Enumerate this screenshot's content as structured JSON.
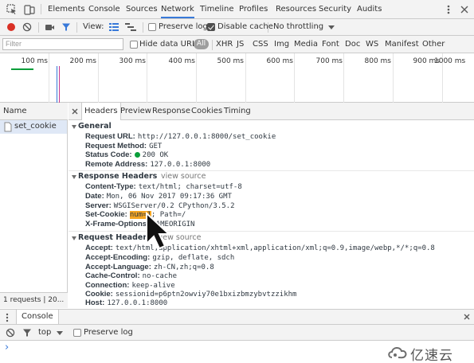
{
  "tabbar": {
    "tabs": [
      "Elements",
      "Console",
      "Sources",
      "Network",
      "Timeline",
      "Profiles",
      "Resources",
      "Security",
      "Audits"
    ],
    "active": "Network"
  },
  "toolbar": {
    "view_label": "View:",
    "preserve_log": "Preserve log",
    "disable_cache": "Disable cache",
    "throttle": "No throttling"
  },
  "filterbar": {
    "placeholder": "Filter",
    "hide_data_urls": "Hide data URLs",
    "all": "All",
    "types": [
      "XHR",
      "JS",
      "CSS",
      "Img",
      "Media",
      "Font",
      "Doc",
      "WS",
      "Manifest",
      "Other"
    ]
  },
  "overview": {
    "ticks": [
      "100 ms",
      "200 ms",
      "300 ms",
      "400 ms",
      "500 ms",
      "600 ms",
      "700 ms",
      "800 ms",
      "900 ms",
      "1000 ms"
    ]
  },
  "requests": {
    "header": "Name",
    "items": [
      "set_cookie"
    ],
    "status": "1 requests  |  20..."
  },
  "details": {
    "tabs": [
      "Headers",
      "Preview",
      "Response",
      "Cookies",
      "Timing"
    ],
    "active": "Headers",
    "general": {
      "title": "General",
      "rows": [
        {
          "name": "Request URL:",
          "value": "http://127.0.0.1:8000/set_cookie"
        },
        {
          "name": "Request Method:",
          "value": "GET"
        },
        {
          "name": "Status Code:",
          "value": "200 OK"
        },
        {
          "name": "Remote Address:",
          "value": "127.0.0.1:8000"
        }
      ]
    },
    "response": {
      "title": "Response Headers",
      "view_source": "view source",
      "rows": [
        {
          "name": "Content-Type:",
          "value": "text/html; charset=utf-8"
        },
        {
          "name": "Date:",
          "value": "Mon, 06 Nov 2017 09:17:36 GMT"
        },
        {
          "name": "Server:",
          "value": "WSGIServer/0.2 CPython/3.5.2"
        },
        {
          "name": "Set-Cookie:",
          "value_highlight": "num=1",
          "value": "; Path=/"
        },
        {
          "name": "X-Frame-Options:",
          "value": "SAMEORIGIN"
        }
      ]
    },
    "request": {
      "title": "Request Headers",
      "view_source": "view source",
      "rows": [
        {
          "name": "Accept:",
          "value": "text/html,application/xhtml+xml,application/xml;q=0.9,image/webp,*/*;q=0.8"
        },
        {
          "name": "Accept-Encoding:",
          "value": "gzip, deflate, sdch"
        },
        {
          "name": "Accept-Language:",
          "value": "zh-CN,zh;q=0.8"
        },
        {
          "name": "Cache-Control:",
          "value": "no-cache"
        },
        {
          "name": "Connection:",
          "value": "keep-alive"
        },
        {
          "name": "Cookie:",
          "value": "sessionid=p6ptn2owviy70e1bxizbmzybvtzzikhm"
        },
        {
          "name": "Host:",
          "value": "127.0.0.1:8000"
        }
      ]
    }
  },
  "drawer": {
    "tab": "Console",
    "context": "top",
    "preserve_log": "Preserve log",
    "prompt": "›"
  },
  "watermark": {
    "text": "亿速云"
  },
  "colors": {
    "accent": "#3879d9",
    "record": "#d93025",
    "status_ok": "#0a9e3a",
    "highlight": "#f5a623"
  }
}
